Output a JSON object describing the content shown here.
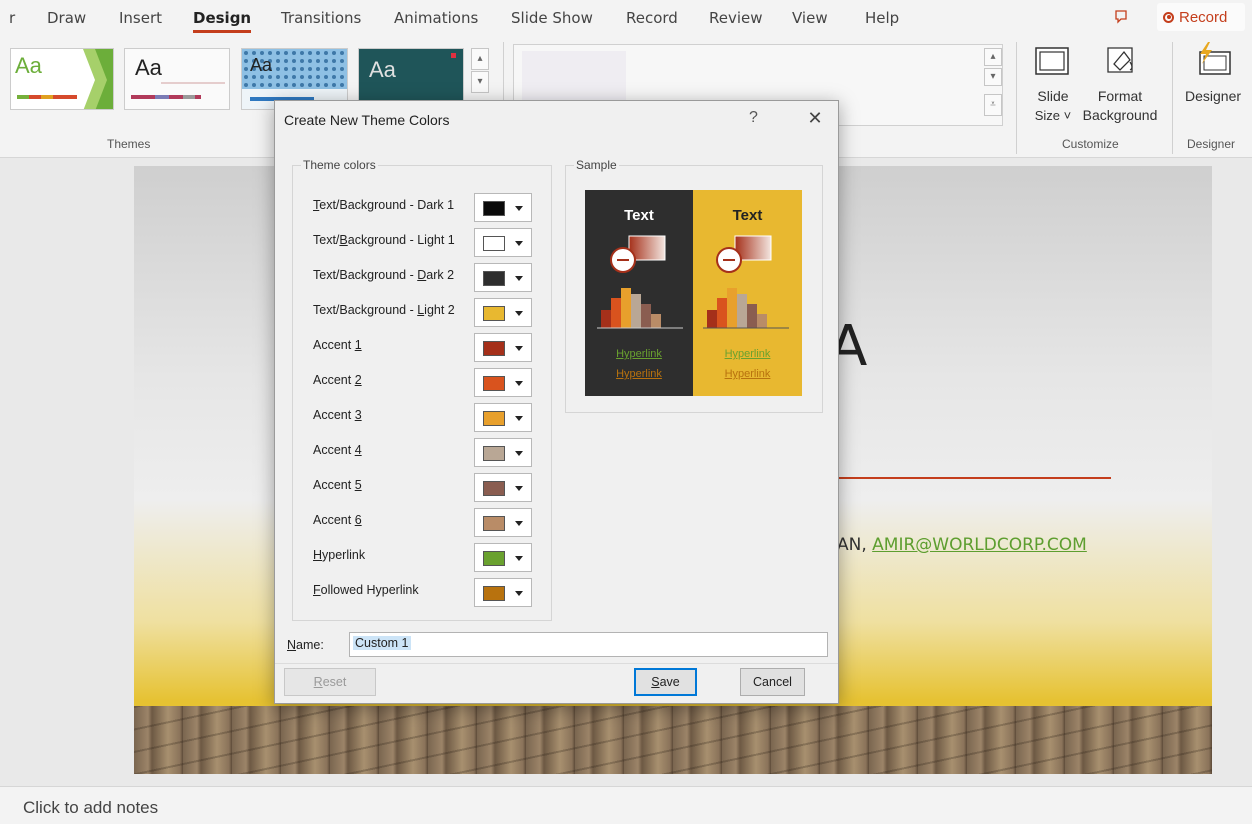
{
  "ribbon": {
    "tabs": [
      {
        "label": "r"
      },
      {
        "label": "Draw"
      },
      {
        "label": "Insert"
      },
      {
        "label": "Design"
      },
      {
        "label": "Transitions"
      },
      {
        "label": "Animations"
      },
      {
        "label": "Slide Show"
      },
      {
        "label": "Record"
      },
      {
        "label": "Review"
      },
      {
        "label": "View"
      },
      {
        "label": "Help"
      }
    ],
    "record_button": "Record",
    "themes_group_label": "Themes",
    "theme_thumb_text": "Aa",
    "slide_size_line1": "Slide",
    "slide_size_line2": "Size ˅",
    "format_background_line1": "Format",
    "format_background_line2": "Background",
    "customize_group_label": "Customize",
    "designer_label": "Designer",
    "designer_group_label": "Designer"
  },
  "slide": {
    "big_letter": "A",
    "subtitle_prefix": "AN, ",
    "email": "AMIR@WORLDCORP.COM"
  },
  "notes": {
    "placeholder": "Click to add notes"
  },
  "dialog": {
    "title": "Create New Theme Colors",
    "help": "?",
    "close": "✕",
    "theme_colors_legend": "Theme colors",
    "sample_legend": "Sample",
    "rows": [
      {
        "pre": "",
        "key": "T",
        "post": "ext/Background - Dark 1",
        "color": "#0a0a0a"
      },
      {
        "pre": "Text/",
        "key": "B",
        "post": "ackground - Light 1",
        "color": "#ffffff"
      },
      {
        "pre": "Text/Background - ",
        "key": "D",
        "post": "ark 2",
        "color": "#2e2e2e"
      },
      {
        "pre": "Text/Background - ",
        "key": "L",
        "post": "ight 2",
        "color": "#e8b830"
      },
      {
        "pre": "Accent ",
        "key": "1",
        "post": "",
        "color": "#a5301a"
      },
      {
        "pre": "Accent ",
        "key": "2",
        "post": "",
        "color": "#d9531e"
      },
      {
        "pre": "Accent ",
        "key": "3",
        "post": "",
        "color": "#e8a02c"
      },
      {
        "pre": "Accent ",
        "key": "4",
        "post": "",
        "color": "#b9a795"
      },
      {
        "pre": "Accent ",
        "key": "5",
        "post": "",
        "color": "#8a5d50"
      },
      {
        "pre": "Accent ",
        "key": "6",
        "post": "",
        "color": "#b98c67"
      },
      {
        "pre": "",
        "key": "H",
        "post": "yperlink",
        "color": "#6aa12f"
      },
      {
        "pre": "",
        "key": "F",
        "post": "ollowed Hyperlink",
        "color": "#b8720e"
      }
    ],
    "sample": {
      "text_label": "Text",
      "hyperlink_label": "Hyperlink",
      "followed_label": "Hyperlink"
    },
    "name_label_key": "N",
    "name_label_rest": "ame:",
    "name_value": "Custom 1",
    "reset_key": "R",
    "reset_rest": "eset",
    "save_key": "S",
    "save_rest": "ave",
    "cancel_label": "Cancel"
  },
  "colors": {
    "accent": "#c43e1c",
    "dialog_bg": "#f0f0f0",
    "hyperlink_green": "#6aa12f",
    "followed_orange": "#b8720e"
  }
}
